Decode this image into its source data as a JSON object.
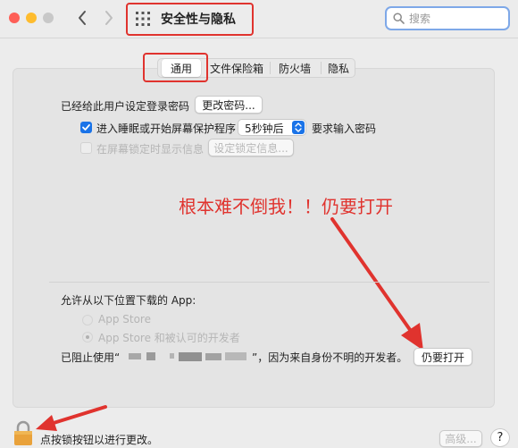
{
  "window": {
    "title": "安全性与隐私",
    "search_placeholder": "搜索",
    "nav_back_icon": "chevron-left-icon",
    "nav_forward_icon": "chevron-right-icon",
    "grid_icon": "grid-icon"
  },
  "tabs": [
    {
      "label": "通用",
      "selected": true
    },
    {
      "label": "文件保险箱",
      "selected": false
    },
    {
      "label": "防火墙",
      "selected": false
    },
    {
      "label": "隐私",
      "selected": false
    }
  ],
  "general": {
    "password_text": "已经给此用户设定登录密码",
    "change_password_button": "更改密码...",
    "sleep_checkbox_label": "进入睡眠或开始屏幕保护程序",
    "sleep_checked": true,
    "sleep_delay_value": "5秒钟后",
    "require_password_text": "要求输入密码",
    "lock_message_checkbox_label": "在屏幕锁定时显示信息",
    "lock_message_checked": false,
    "set_lock_message_button": "设定锁定信息..."
  },
  "annotation": {
    "text": "根本难不倒我！！仍要打开",
    "color": "#e0332e"
  },
  "downloads": {
    "heading": "允许从以下位置下载的 App:",
    "options": [
      {
        "label": "App Store",
        "selected": false
      },
      {
        "label": "App Store 和被认可的开发者",
        "selected": true
      }
    ],
    "blocked_prefix": "已阻止使用“",
    "blocked_suffix": "”，因为来自身份不明的开发者。",
    "open_anyway_button": "仍要打开"
  },
  "footer": {
    "lock_icon": "padlock-icon",
    "lock_text": "点按锁按钮以进行更改。",
    "advanced_button": "高级...",
    "help_button": "?"
  },
  "colors": {
    "accent": "#1a73e8",
    "highlight_red": "#e0332e",
    "panel_bg": "#e4e4e4",
    "window_bg": "#ececec"
  }
}
